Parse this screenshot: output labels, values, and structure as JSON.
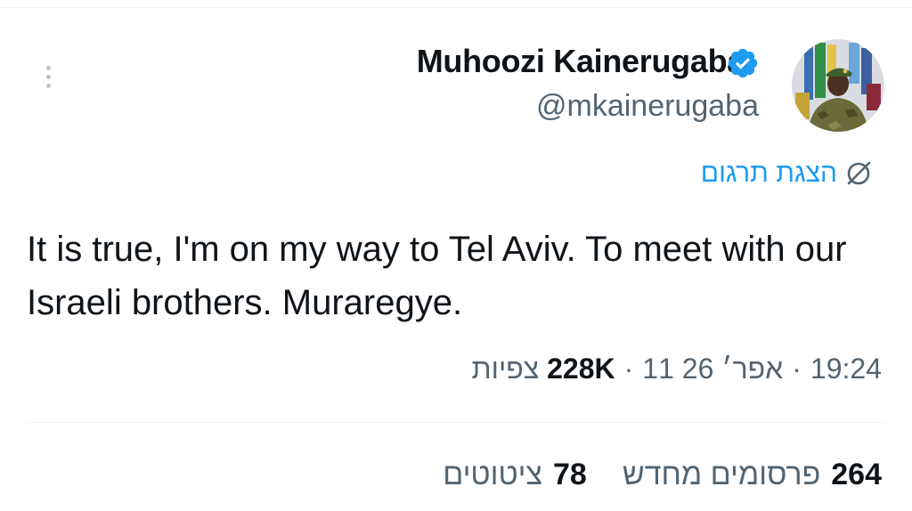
{
  "author": {
    "name": "Muhoozi Kainerugaba",
    "handle": "@mkainerugaba"
  },
  "translate_label": "הצגת תרגום",
  "tweet": {
    "text": "It is true, I'm on my way to Tel Aviv. To meet with our Israeli brothers. Muraregye.",
    "time": "19:24",
    "date": "11 אפר׳ 26",
    "views_count": "228K",
    "views_label": "צפיות",
    "separator": "·"
  },
  "stats": {
    "reposts_count": "264",
    "reposts_label": "פרסומים מחדש",
    "quotes_count": "78",
    "quotes_label": "ציטוטים"
  },
  "colors": {
    "accent": "#1d9bf0",
    "secondary_text": "#536471",
    "primary_text": "#0f1419",
    "divider": "#eff3f4"
  }
}
